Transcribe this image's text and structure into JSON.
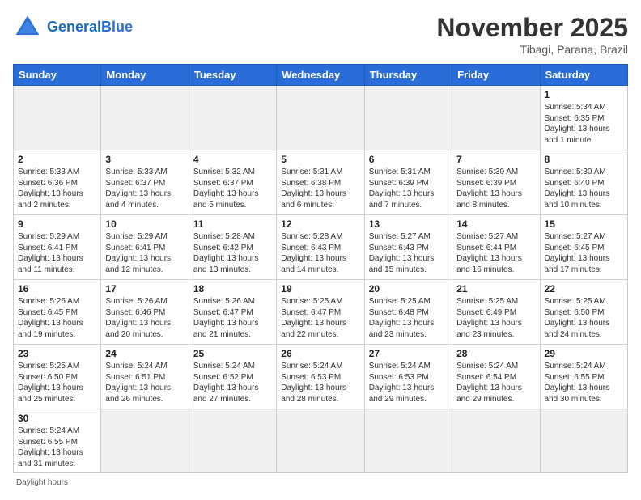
{
  "header": {
    "logo_general": "General",
    "logo_blue": "Blue",
    "month_title": "November 2025",
    "location": "Tibagi, Parana, Brazil"
  },
  "weekdays": [
    "Sunday",
    "Monday",
    "Tuesday",
    "Wednesday",
    "Thursday",
    "Friday",
    "Saturday"
  ],
  "weeks": [
    [
      {
        "day": "",
        "empty": true
      },
      {
        "day": "",
        "empty": true
      },
      {
        "day": "",
        "empty": true
      },
      {
        "day": "",
        "empty": true
      },
      {
        "day": "",
        "empty": true
      },
      {
        "day": "",
        "empty": true
      },
      {
        "day": "1",
        "sunrise": "5:34 AM",
        "sunset": "6:35 PM",
        "daylight": "13 hours and 1 minute."
      }
    ],
    [
      {
        "day": "2",
        "sunrise": "5:33 AM",
        "sunset": "6:36 PM",
        "daylight": "13 hours and 2 minutes."
      },
      {
        "day": "3",
        "sunrise": "5:33 AM",
        "sunset": "6:37 PM",
        "daylight": "13 hours and 4 minutes."
      },
      {
        "day": "4",
        "sunrise": "5:32 AM",
        "sunset": "6:37 PM",
        "daylight": "13 hours and 5 minutes."
      },
      {
        "day": "5",
        "sunrise": "5:31 AM",
        "sunset": "6:38 PM",
        "daylight": "13 hours and 6 minutes."
      },
      {
        "day": "6",
        "sunrise": "5:31 AM",
        "sunset": "6:39 PM",
        "daylight": "13 hours and 7 minutes."
      },
      {
        "day": "7",
        "sunrise": "5:30 AM",
        "sunset": "6:39 PM",
        "daylight": "13 hours and 8 minutes."
      },
      {
        "day": "8",
        "sunrise": "5:30 AM",
        "sunset": "6:40 PM",
        "daylight": "13 hours and 10 minutes."
      }
    ],
    [
      {
        "day": "9",
        "sunrise": "5:29 AM",
        "sunset": "6:41 PM",
        "daylight": "13 hours and 11 minutes."
      },
      {
        "day": "10",
        "sunrise": "5:29 AM",
        "sunset": "6:41 PM",
        "daylight": "13 hours and 12 minutes."
      },
      {
        "day": "11",
        "sunrise": "5:28 AM",
        "sunset": "6:42 PM",
        "daylight": "13 hours and 13 minutes."
      },
      {
        "day": "12",
        "sunrise": "5:28 AM",
        "sunset": "6:43 PM",
        "daylight": "13 hours and 14 minutes."
      },
      {
        "day": "13",
        "sunrise": "5:27 AM",
        "sunset": "6:43 PM",
        "daylight": "13 hours and 15 minutes."
      },
      {
        "day": "14",
        "sunrise": "5:27 AM",
        "sunset": "6:44 PM",
        "daylight": "13 hours and 16 minutes."
      },
      {
        "day": "15",
        "sunrise": "5:27 AM",
        "sunset": "6:45 PM",
        "daylight": "13 hours and 17 minutes."
      }
    ],
    [
      {
        "day": "16",
        "sunrise": "5:26 AM",
        "sunset": "6:45 PM",
        "daylight": "13 hours and 19 minutes."
      },
      {
        "day": "17",
        "sunrise": "5:26 AM",
        "sunset": "6:46 PM",
        "daylight": "13 hours and 20 minutes."
      },
      {
        "day": "18",
        "sunrise": "5:26 AM",
        "sunset": "6:47 PM",
        "daylight": "13 hours and 21 minutes."
      },
      {
        "day": "19",
        "sunrise": "5:25 AM",
        "sunset": "6:47 PM",
        "daylight": "13 hours and 22 minutes."
      },
      {
        "day": "20",
        "sunrise": "5:25 AM",
        "sunset": "6:48 PM",
        "daylight": "13 hours and 23 minutes."
      },
      {
        "day": "21",
        "sunrise": "5:25 AM",
        "sunset": "6:49 PM",
        "daylight": "13 hours and 23 minutes."
      },
      {
        "day": "22",
        "sunrise": "5:25 AM",
        "sunset": "6:50 PM",
        "daylight": "13 hours and 24 minutes."
      }
    ],
    [
      {
        "day": "23",
        "sunrise": "5:25 AM",
        "sunset": "6:50 PM",
        "daylight": "13 hours and 25 minutes."
      },
      {
        "day": "24",
        "sunrise": "5:24 AM",
        "sunset": "6:51 PM",
        "daylight": "13 hours and 26 minutes."
      },
      {
        "day": "25",
        "sunrise": "5:24 AM",
        "sunset": "6:52 PM",
        "daylight": "13 hours and 27 minutes."
      },
      {
        "day": "26",
        "sunrise": "5:24 AM",
        "sunset": "6:53 PM",
        "daylight": "13 hours and 28 minutes."
      },
      {
        "day": "27",
        "sunrise": "5:24 AM",
        "sunset": "6:53 PM",
        "daylight": "13 hours and 29 minutes."
      },
      {
        "day": "28",
        "sunrise": "5:24 AM",
        "sunset": "6:54 PM",
        "daylight": "13 hours and 29 minutes."
      },
      {
        "day": "29",
        "sunrise": "5:24 AM",
        "sunset": "6:55 PM",
        "daylight": "13 hours and 30 minutes."
      }
    ],
    [
      {
        "day": "30",
        "sunrise": "5:24 AM",
        "sunset": "6:55 PM",
        "daylight": "13 hours and 31 minutes."
      },
      {
        "day": "",
        "empty": true
      },
      {
        "day": "",
        "empty": true
      },
      {
        "day": "",
        "empty": true
      },
      {
        "day": "",
        "empty": true
      },
      {
        "day": "",
        "empty": true
      },
      {
        "day": "",
        "empty": true
      }
    ]
  ],
  "footer": "Daylight hours"
}
